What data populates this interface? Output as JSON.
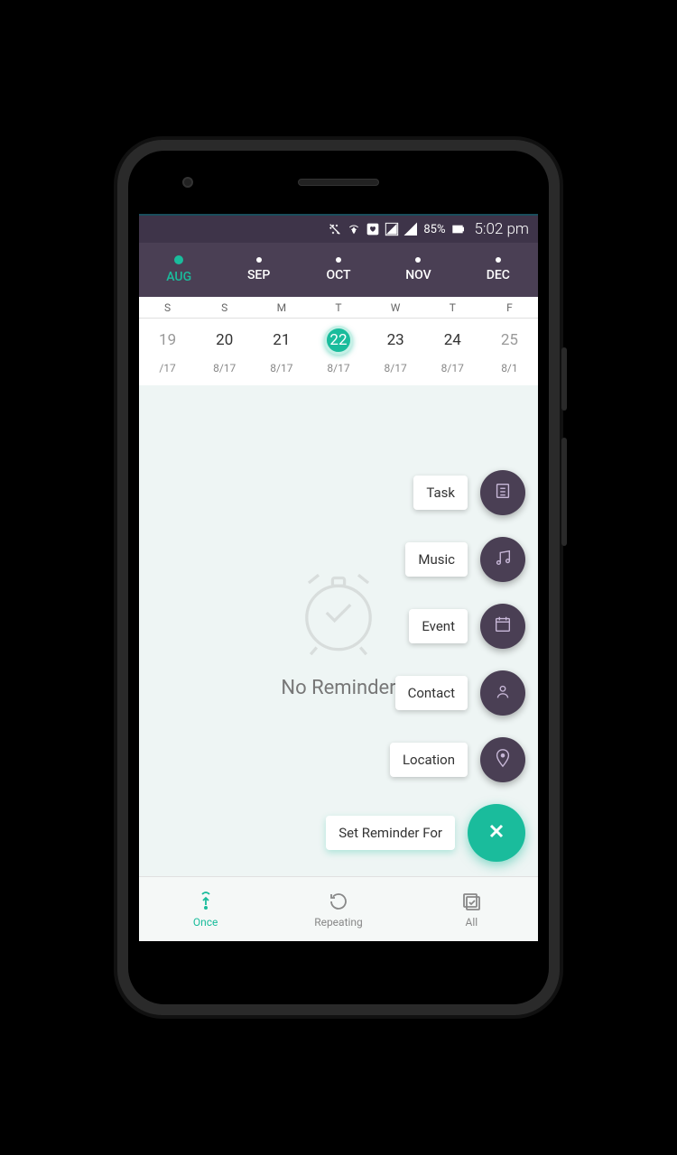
{
  "status": {
    "battery": "85%",
    "time": "5:02 pm"
  },
  "months": [
    {
      "label": "AUG",
      "active": true
    },
    {
      "label": "SEP",
      "active": false
    },
    {
      "label": "OCT",
      "active": false
    },
    {
      "label": "NOV",
      "active": false
    },
    {
      "label": "DEC",
      "active": false
    }
  ],
  "day_letters": [
    "S",
    "S",
    "M",
    "T",
    "W",
    "T",
    "F"
  ],
  "dates": [
    {
      "num": "19",
      "selected": false,
      "edge": true
    },
    {
      "num": "20",
      "selected": false
    },
    {
      "num": "21",
      "selected": false
    },
    {
      "num": "22",
      "selected": true
    },
    {
      "num": "23",
      "selected": false
    },
    {
      "num": "24",
      "selected": false
    },
    {
      "num": "25",
      "selected": false,
      "edge": true
    }
  ],
  "sub_dates": [
    "/17",
    "8/17",
    "8/17",
    "8/17",
    "8/17",
    "8/17",
    "8/1"
  ],
  "empty": {
    "text": "No Reminder"
  },
  "fab": {
    "items": [
      {
        "label": "Task",
        "icon": "task"
      },
      {
        "label": "Music",
        "icon": "music"
      },
      {
        "label": "Event",
        "icon": "event"
      },
      {
        "label": "Contact",
        "icon": "contact"
      },
      {
        "label": "Location",
        "icon": "location"
      }
    ],
    "main_label": "Set Reminder For"
  },
  "nav": {
    "once": "Once",
    "repeating": "Repeating",
    "all": "All"
  }
}
